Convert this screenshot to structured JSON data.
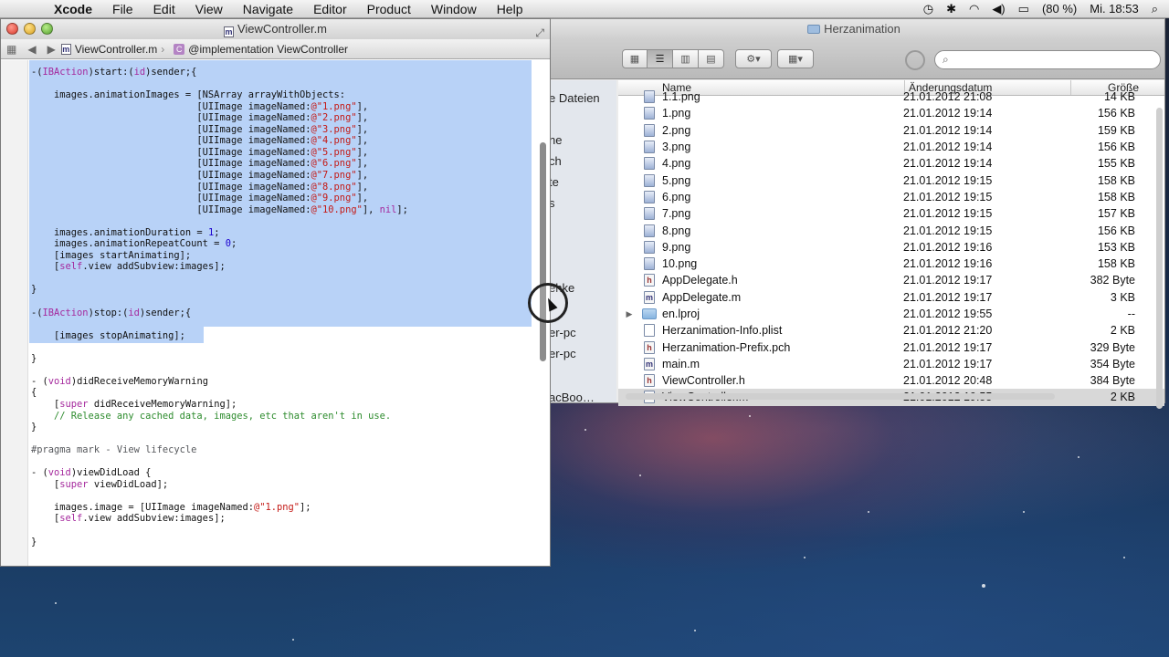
{
  "menubar": {
    "apple": "",
    "app_name": "Xcode",
    "items": [
      "File",
      "Edit",
      "View",
      "Navigate",
      "Editor",
      "Product",
      "Window",
      "Help"
    ],
    "battery": "(80 %)",
    "clock": "Mi. 18:53"
  },
  "finder": {
    "title": "Herzanimation",
    "sidebar_fragments": [
      "e Dateien",
      "ne",
      "ch",
      "te",
      "s",
      "ehke",
      "er-pc",
      "er-pc",
      "acBoo…"
    ],
    "columns": {
      "name": "Name",
      "date": "Änderungsdatum",
      "size": "Größe"
    },
    "rows": [
      {
        "name": "1.1.png",
        "date": "21.01.2012 21:08",
        "size": "14 KB",
        "kind": "png"
      },
      {
        "name": "1.png",
        "date": "21.01.2012 19:14",
        "size": "156 KB",
        "kind": "png"
      },
      {
        "name": "2.png",
        "date": "21.01.2012 19:14",
        "size": "159 KB",
        "kind": "png"
      },
      {
        "name": "3.png",
        "date": "21.01.2012 19:14",
        "size": "156 KB",
        "kind": "png"
      },
      {
        "name": "4.png",
        "date": "21.01.2012 19:14",
        "size": "155 KB",
        "kind": "png"
      },
      {
        "name": "5.png",
        "date": "21.01.2012 19:15",
        "size": "158 KB",
        "kind": "png"
      },
      {
        "name": "6.png",
        "date": "21.01.2012 19:15",
        "size": "158 KB",
        "kind": "png"
      },
      {
        "name": "7.png",
        "date": "21.01.2012 19:15",
        "size": "157 KB",
        "kind": "png"
      },
      {
        "name": "8.png",
        "date": "21.01.2012 19:15",
        "size": "156 KB",
        "kind": "png"
      },
      {
        "name": "9.png",
        "date": "21.01.2012 19:16",
        "size": "153 KB",
        "kind": "png"
      },
      {
        "name": "10.png",
        "date": "21.01.2012 19:16",
        "size": "158 KB",
        "kind": "png"
      },
      {
        "name": "AppDelegate.h",
        "date": "21.01.2012 19:17",
        "size": "382 Byte",
        "kind": "h"
      },
      {
        "name": "AppDelegate.m",
        "date": "21.01.2012 19:17",
        "size": "3 KB",
        "kind": "m"
      },
      {
        "name": "en.lproj",
        "date": "21.01.2012 19:55",
        "size": "--",
        "kind": "folder"
      },
      {
        "name": "Herzanimation-Info.plist",
        "date": "21.01.2012 21:20",
        "size": "2 KB",
        "kind": "plain"
      },
      {
        "name": "Herzanimation-Prefix.pch",
        "date": "21.01.2012 19:17",
        "size": "329 Byte",
        "kind": "h"
      },
      {
        "name": "main.m",
        "date": "21.01.2012 19:17",
        "size": "354 Byte",
        "kind": "m"
      },
      {
        "name": "ViewController.h",
        "date": "21.01.2012 20:48",
        "size": "384 Byte",
        "kind": "h"
      },
      {
        "name": "ViewController.m",
        "date": "21.01.2012 19:55",
        "size": "2 KB",
        "kind": "m",
        "selected": true
      }
    ]
  },
  "xcode": {
    "title": "ViewController.m",
    "jumpbar": {
      "file": "ViewController.m",
      "symbol": "@implementation ViewController"
    },
    "code_lines": [
      {
        "t": "-(IBAction)start:(id)sender;{",
        "y": 0
      },
      {
        "t": "    images.animationImages = [NSArray arrayWithObjects:",
        "y": 2
      },
      {
        "t": "                             [UIImage imageNamed:@\"1.png\"],",
        "y": 3
      },
      {
        "t": "                             [UIImage imageNamed:@\"2.png\"],",
        "y": 4
      },
      {
        "t": "                             [UIImage imageNamed:@\"3.png\"],",
        "y": 5
      },
      {
        "t": "                             [UIImage imageNamed:@\"4.png\"],",
        "y": 6
      },
      {
        "t": "                             [UIImage imageNamed:@\"5.png\"],",
        "y": 7
      },
      {
        "t": "                             [UIImage imageNamed:@\"6.png\"],",
        "y": 8
      },
      {
        "t": "                             [UIImage imageNamed:@\"7.png\"],",
        "y": 9
      },
      {
        "t": "                             [UIImage imageNamed:@\"8.png\"],",
        "y": 10
      },
      {
        "t": "                             [UIImage imageNamed:@\"9.png\"],",
        "y": 11
      },
      {
        "t": "                             [UIImage imageNamed:@\"10.png\"], nil];",
        "y": 12
      },
      {
        "t": "    images.animationDuration = 1;",
        "y": 14
      },
      {
        "t": "    images.animationRepeatCount = 0;",
        "y": 15
      },
      {
        "t": "    [images startAnimating];",
        "y": 16
      },
      {
        "t": "    [self.view addSubview:images];",
        "y": 17
      },
      {
        "t": "}",
        "y": 19
      },
      {
        "t": "-(IBAction)stop:(id)sender;{",
        "y": 21
      },
      {
        "t": "    [images stopAnimating];",
        "y": 23
      },
      {
        "t": "}",
        "y": 25
      },
      {
        "t": "- (void)didReceiveMemoryWarning",
        "y": 27
      },
      {
        "t": "{",
        "y": 28
      },
      {
        "t": "    [super didReceiveMemoryWarning];",
        "y": 29
      },
      {
        "t": "    // Release any cached data, images, etc that aren't in use.",
        "y": 30
      },
      {
        "t": "}",
        "y": 31
      },
      {
        "t": "#pragma mark - View lifecycle",
        "y": 33
      },
      {
        "t": "- (void)viewDidLoad {",
        "y": 35
      },
      {
        "t": "    [super viewDidLoad];",
        "y": 36
      },
      {
        "t": "    images.image = [UIImage imageNamed:@\"1.png\"];",
        "y": 38
      },
      {
        "t": "    [self.view addSubview:images];",
        "y": 39
      },
      {
        "t": "}",
        "y": 41
      }
    ]
  }
}
